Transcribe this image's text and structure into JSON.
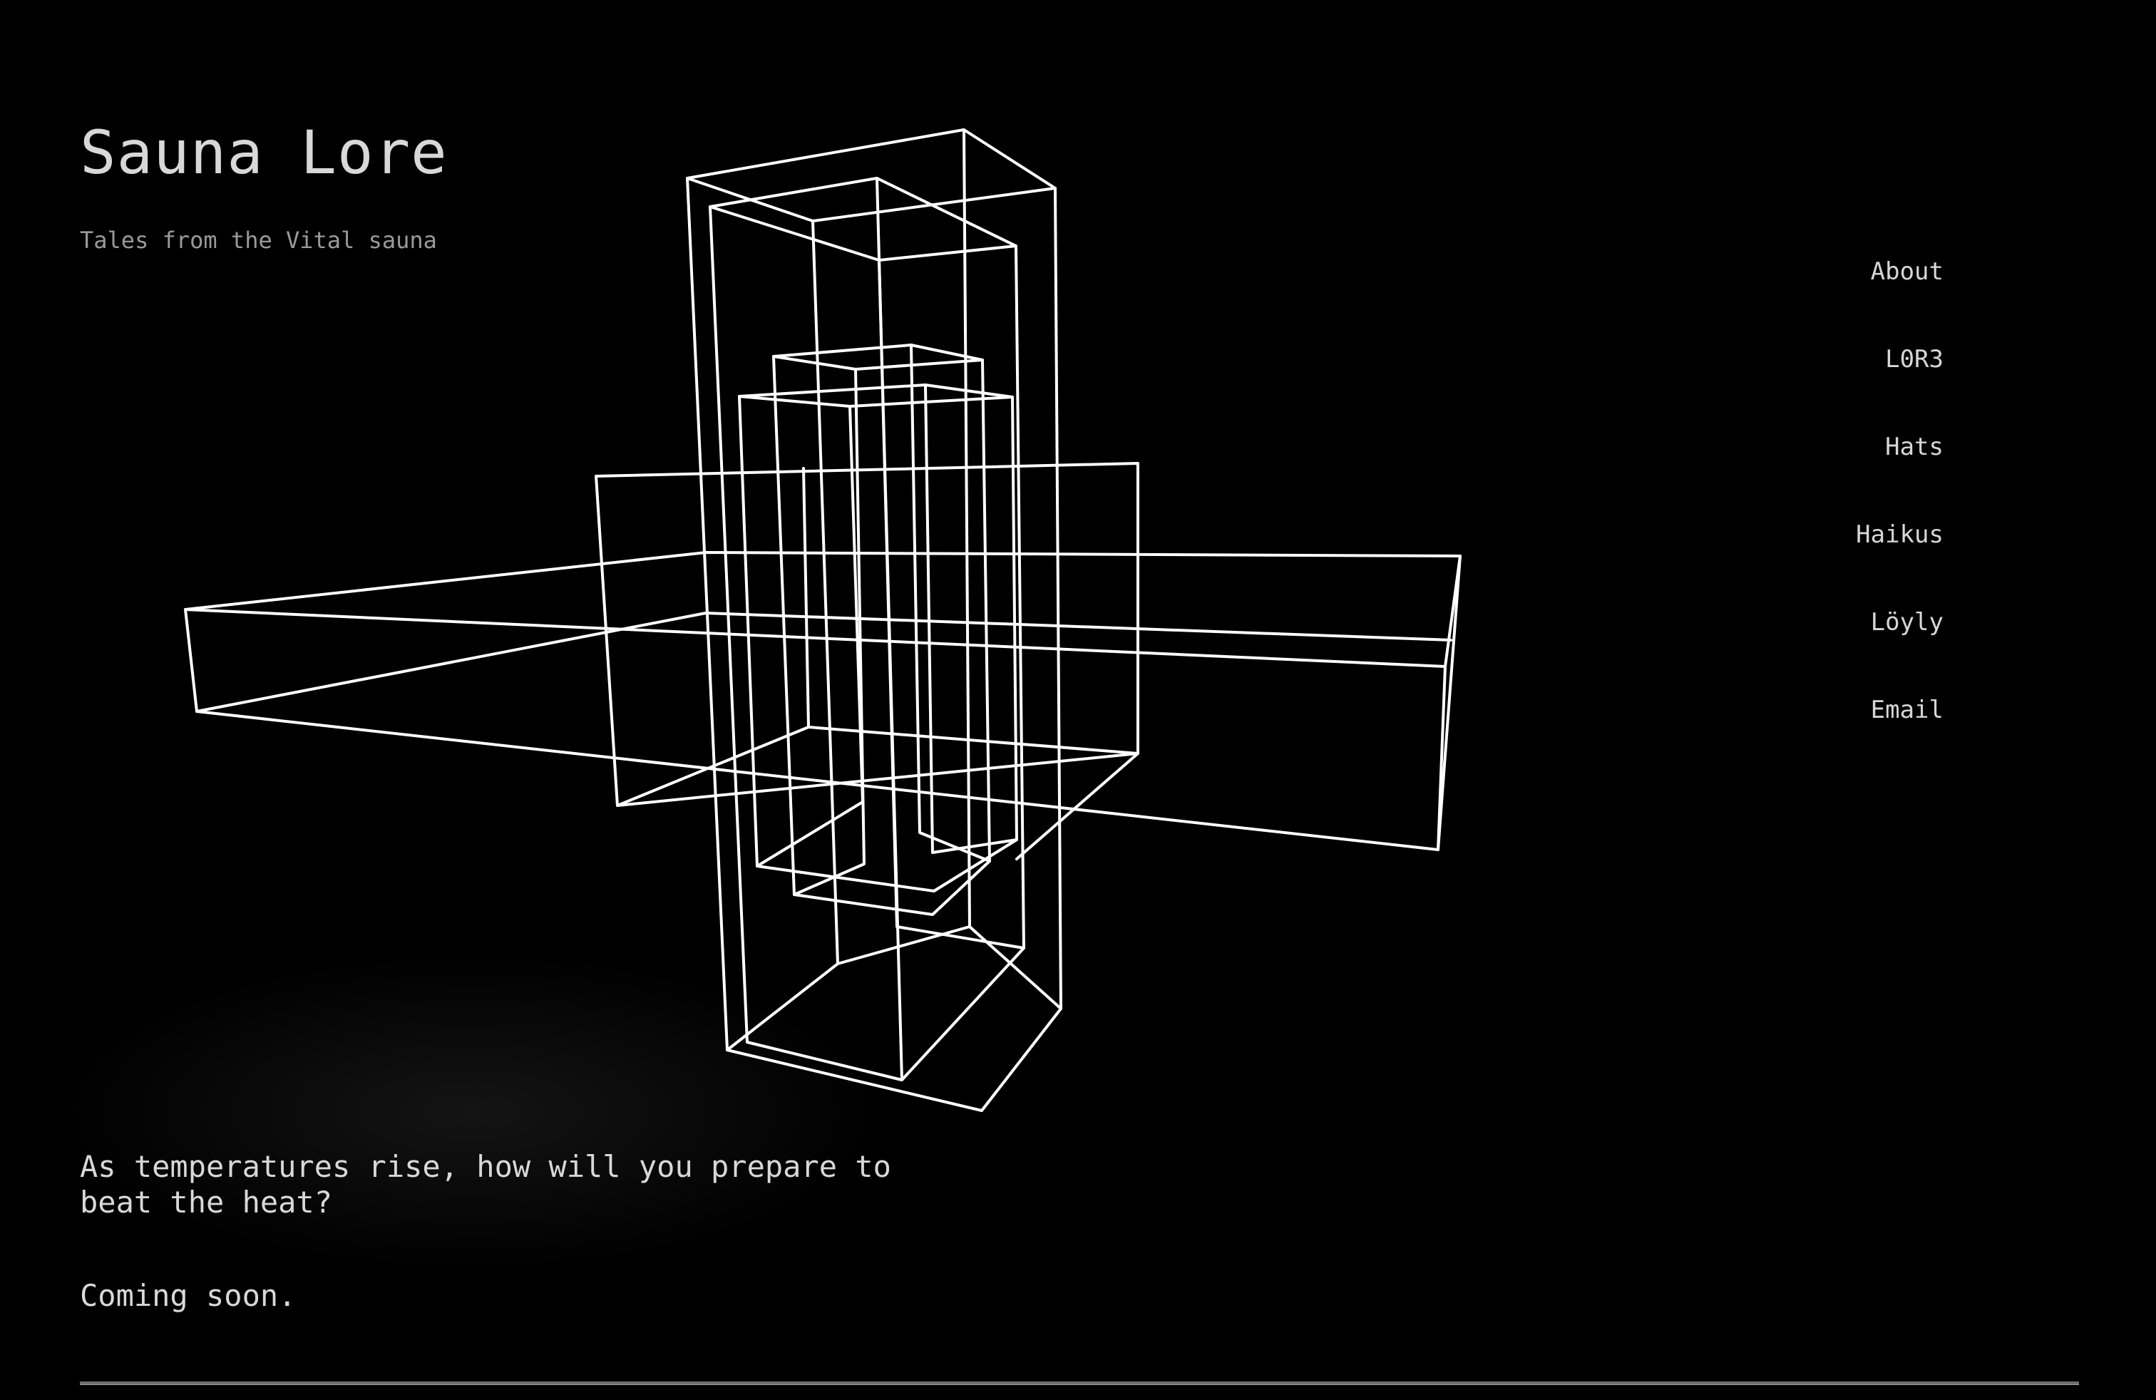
{
  "site": {
    "title": "Sauna Lore",
    "tagline": "Tales from the Vital sauna"
  },
  "nav": {
    "items": [
      {
        "label": "About"
      },
      {
        "label": "L0R3"
      },
      {
        "label": "Hats"
      },
      {
        "label": "Haikus"
      },
      {
        "label": "Löyly"
      },
      {
        "label": "Email"
      }
    ]
  },
  "main": {
    "lead": "As temperatures rise, how will you prepare to beat the heat?",
    "status": "Coming soon."
  },
  "colors": {
    "background": "#000000",
    "text": "#d6d6d6",
    "muted": "#9a9a9a",
    "wireframe": "#ffffff"
  },
  "illustration": {
    "icon": "wireframe-boxes-icon"
  }
}
